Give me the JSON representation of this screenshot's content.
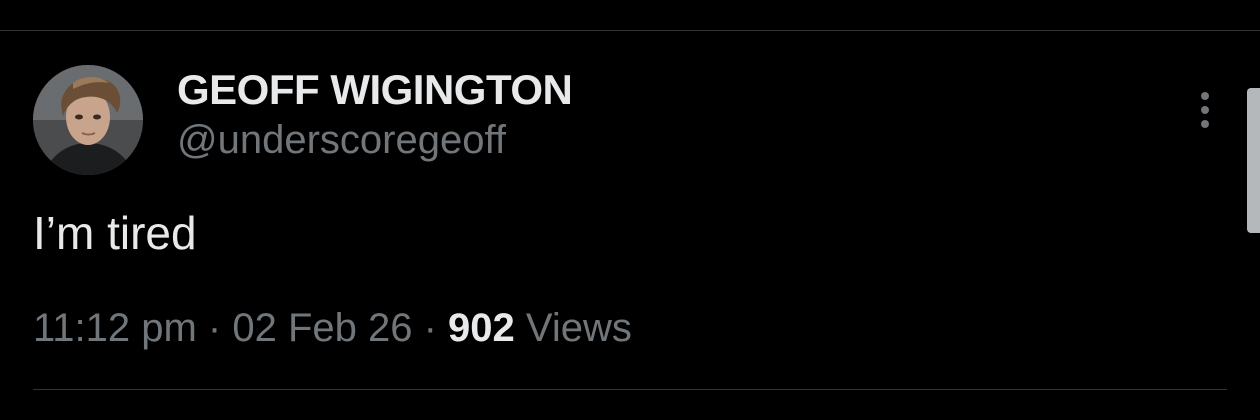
{
  "tweet": {
    "author": {
      "display_name": "GEOFF WIGINGTON",
      "handle": "@underscoregeoff"
    },
    "text": "I’m tired",
    "time": "11:12 pm",
    "date": "02 Feb 26",
    "separator": " · ",
    "views_count": "902",
    "views_label": " Views"
  },
  "icons": {
    "more": "more-vertical-icon"
  },
  "colors": {
    "background": "#000000",
    "primary_text": "#e7e9ea",
    "secondary_text": "#71767b",
    "divider": "#2f3336"
  }
}
